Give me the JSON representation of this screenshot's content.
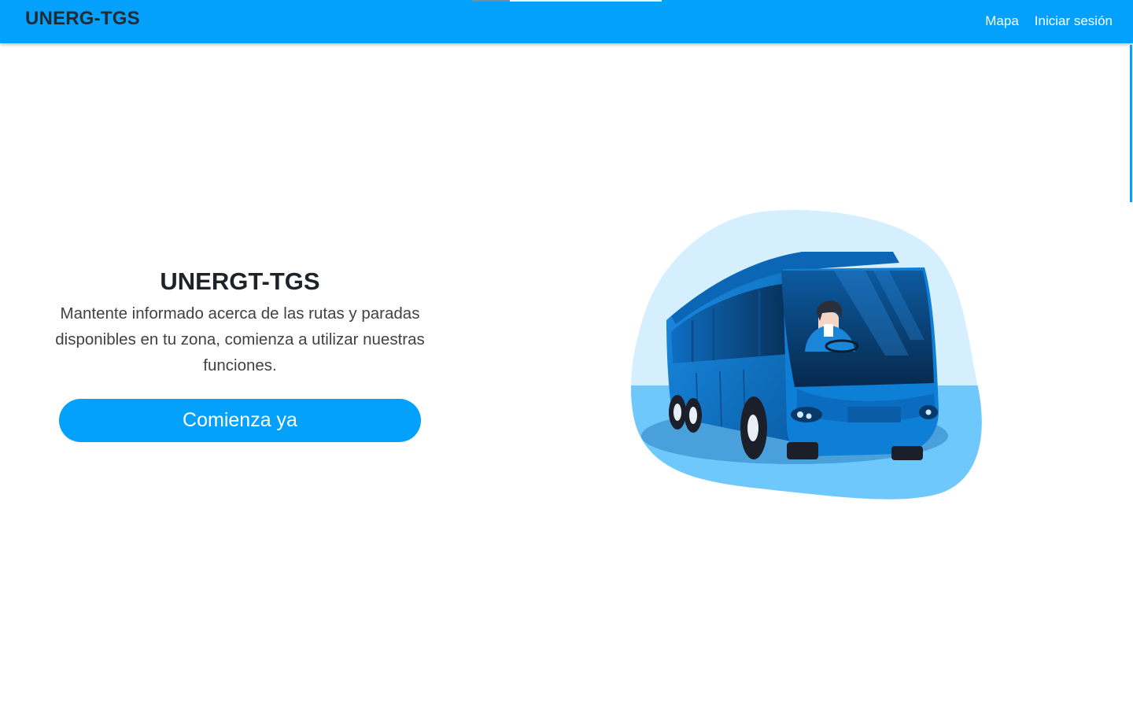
{
  "navbar": {
    "brand": "UNERG-TGS",
    "links": [
      {
        "label": "Mapa"
      },
      {
        "label": "Iniciar sesión"
      }
    ]
  },
  "hero": {
    "title": "UNERGT-TGS",
    "description": "Mantente informado acerca de las rutas y paradas disponibles en tu zona, comienza a utilizar nuestras funciones.",
    "cta_label": "Comienza ya"
  },
  "illustration": {
    "subject": "bus-with-driver"
  },
  "colors": {
    "primary": "#03a1fc",
    "brand_text": "#1f2a33",
    "blob_light": "#d5efff",
    "blob_mid": "#6ec8fb",
    "bus_blue": "#0d75c8"
  }
}
